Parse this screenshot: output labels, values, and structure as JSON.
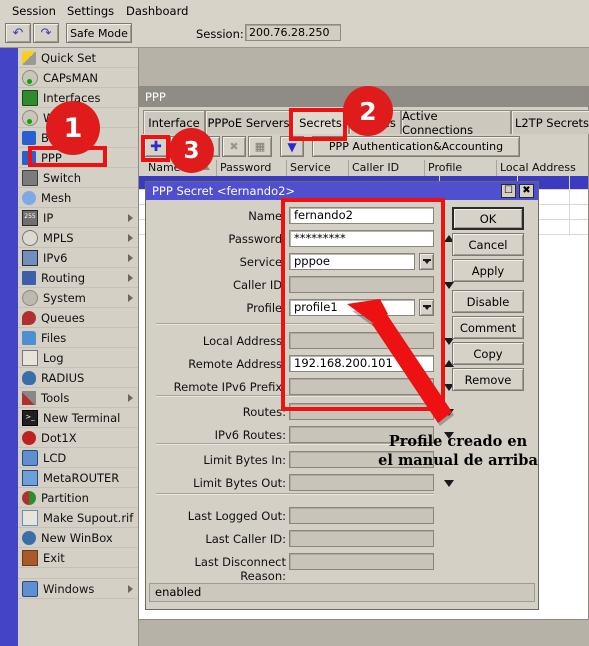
{
  "menubar": {
    "items": [
      {
        "label": "Session"
      },
      {
        "label": "Settings"
      },
      {
        "label": "Dashboard"
      }
    ]
  },
  "toolbar": {
    "undo_icon": "undo-icon",
    "redo_icon": "redo-icon",
    "safe_mode_label": "Safe Mode",
    "session_label": "Session:",
    "session_value": "200.76.28.250"
  },
  "sidebar": {
    "items": [
      {
        "label": "Quick Set",
        "icon": "quick-set-icon",
        "submenu": false
      },
      {
        "label": "CAPsMAN",
        "icon": "capsman-icon",
        "submenu": false
      },
      {
        "label": "Interfaces",
        "icon": "interfaces-icon",
        "submenu": false
      },
      {
        "label": "Wireless",
        "icon": "wireless-icon",
        "submenu": false
      },
      {
        "label": "Bridge",
        "icon": "bridge-icon",
        "submenu": false
      },
      {
        "label": "PPP",
        "icon": "ppp-icon",
        "submenu": false
      },
      {
        "label": "Switch",
        "icon": "switch-icon",
        "submenu": false
      },
      {
        "label": "Mesh",
        "icon": "mesh-icon",
        "submenu": false
      },
      {
        "label": "IP",
        "icon": "ip-icon",
        "submenu": true
      },
      {
        "label": "MPLS",
        "icon": "mpls-icon",
        "submenu": true
      },
      {
        "label": "IPv6",
        "icon": "ipv6-icon",
        "submenu": true
      },
      {
        "label": "Routing",
        "icon": "routing-icon",
        "submenu": true
      },
      {
        "label": "System",
        "icon": "system-icon",
        "submenu": true
      },
      {
        "label": "Queues",
        "icon": "queues-icon",
        "submenu": false
      },
      {
        "label": "Files",
        "icon": "files-icon",
        "submenu": false
      },
      {
        "label": "Log",
        "icon": "log-icon",
        "submenu": false
      },
      {
        "label": "RADIUS",
        "icon": "radius-icon",
        "submenu": false
      },
      {
        "label": "Tools",
        "icon": "tools-icon",
        "submenu": true
      },
      {
        "label": "New Terminal",
        "icon": "terminal-icon",
        "submenu": false
      },
      {
        "label": "Dot1X",
        "icon": "dot1x-icon",
        "submenu": false
      },
      {
        "label": "LCD",
        "icon": "lcd-icon",
        "submenu": false
      },
      {
        "label": "MetaROUTER",
        "icon": "metarouter-icon",
        "submenu": false
      },
      {
        "label": "Partition",
        "icon": "partition-icon",
        "submenu": false
      },
      {
        "label": "Make Supout.rif",
        "icon": "supout-icon",
        "submenu": false
      },
      {
        "label": "New WinBox",
        "icon": "winbox-icon",
        "submenu": false
      },
      {
        "label": "Exit",
        "icon": "exit-icon",
        "submenu": false
      }
    ],
    "footer": {
      "label": "Windows",
      "icon": "windows-icon",
      "submenu": true
    }
  },
  "ppp_window": {
    "title": "PPP",
    "tabs": [
      {
        "label": "Interface",
        "selected": false
      },
      {
        "label": "PPPoE Servers",
        "selected": false
      },
      {
        "label": "Secrets",
        "selected": true
      },
      {
        "label": "Profiles",
        "selected": false
      },
      {
        "label": "Active Connections",
        "selected": false
      },
      {
        "label": "L2TP Secrets",
        "selected": false
      }
    ],
    "toolbar": {
      "add_icon": "plus-icon",
      "remove_icon": "minus-icon",
      "enable_icon": "check-icon",
      "disable_icon": "cross-icon",
      "comment_icon": "comment-icon",
      "filter_icon": "filter-icon",
      "ppp_aaa_label": "PPP Authentication&Accounting"
    },
    "table": {
      "columns": [
        "Name",
        "Password",
        "Service",
        "Caller ID",
        "Profile",
        "Local Address"
      ],
      "sort_indicator": "sort-asc-icon",
      "rows": []
    }
  },
  "dialog": {
    "title": "PPP Secret <fernando2>",
    "maximize_icon": "maximize-icon",
    "close_icon": "close-icon",
    "fields": [
      {
        "label": "Name:",
        "value": "fernando2",
        "control": "text"
      },
      {
        "label": "Password:",
        "value": "*********",
        "control": "spinner-up"
      },
      {
        "label": "Service:",
        "value": "pppoe",
        "control": "dropdown"
      },
      {
        "label": "Caller ID:",
        "value": "",
        "control": "caret-down",
        "readonly": true
      },
      {
        "label": "Profile:",
        "value": "profile1",
        "control": "dropdown"
      },
      {
        "label": "Local Address:",
        "value": "",
        "control": "caret-down",
        "readonly": true
      },
      {
        "label": "Remote Address:",
        "value": "192.168.200.101",
        "control": "spinner-up"
      },
      {
        "label": "Remote IPv6 Prefix:",
        "value": "",
        "control": "caret-down",
        "readonly": true
      },
      {
        "label": "Routes:",
        "value": "",
        "control": "caret-down",
        "readonly": true
      },
      {
        "label": "IPv6 Routes:",
        "value": "",
        "control": "caret-down",
        "readonly": true
      },
      {
        "label": "Limit Bytes In:",
        "value": "",
        "control": "none",
        "readonly": true
      },
      {
        "label": "Limit Bytes Out:",
        "value": "",
        "control": "caret-down",
        "readonly": true
      },
      {
        "label": "Last Logged Out:",
        "value": "",
        "control": "none",
        "readonly": true
      },
      {
        "label": "Last Caller ID:",
        "value": "",
        "control": "none",
        "readonly": true
      },
      {
        "label": "Last Disconnect Reason:",
        "value": "",
        "control": "none",
        "readonly": true
      }
    ],
    "buttons": [
      {
        "label": "OK",
        "default": true
      },
      {
        "label": "Cancel",
        "default": false
      },
      {
        "label": "Apply",
        "default": false
      },
      {
        "label": "Disable",
        "default": false
      },
      {
        "label": "Comment",
        "default": false
      },
      {
        "label": "Copy",
        "default": false
      },
      {
        "label": "Remove",
        "default": false
      }
    ],
    "status": "enabled"
  },
  "annotations": {
    "badges": [
      {
        "label": "1"
      },
      {
        "label": "2"
      },
      {
        "label": "3"
      }
    ],
    "note_line1": "Profile creado en",
    "note_line2": "el manual de arriba",
    "accent_color": "#ee1111",
    "badge_color": "#e01b1b"
  }
}
